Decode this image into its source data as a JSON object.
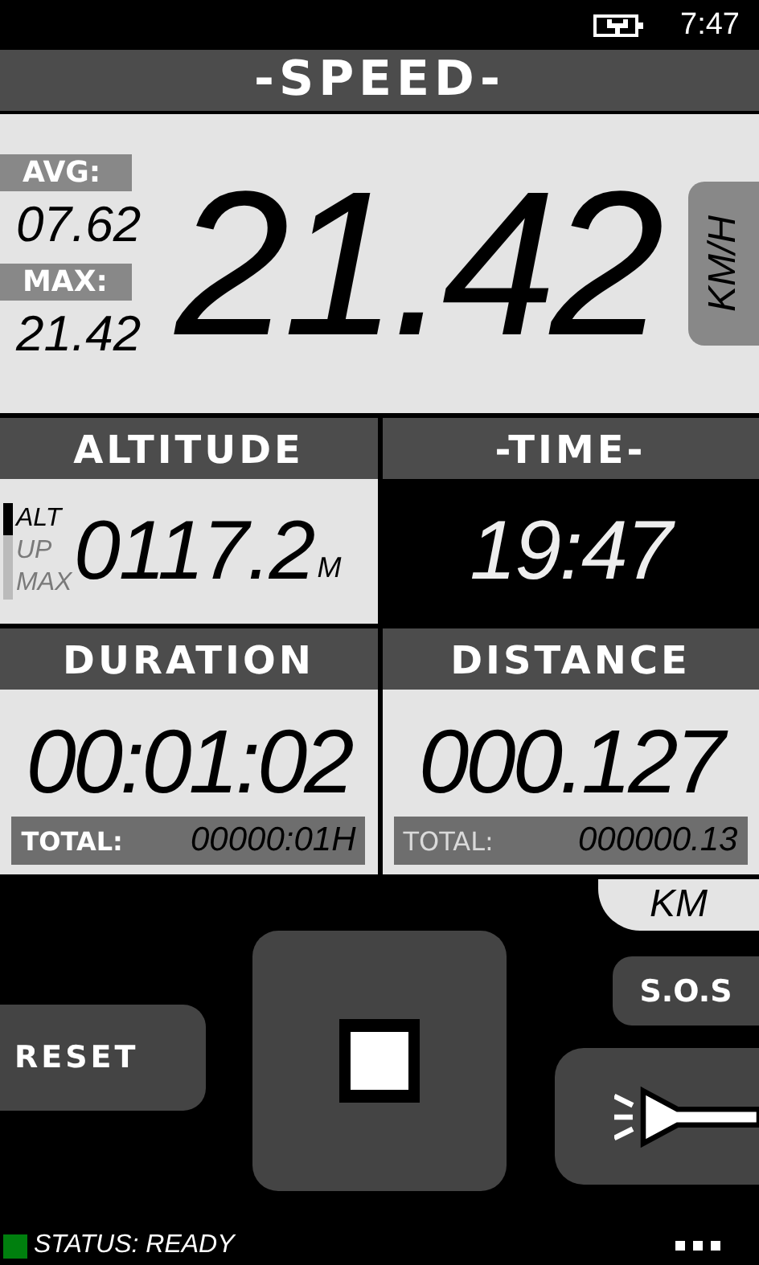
{
  "status_bar": {
    "time": "7:47"
  },
  "speed": {
    "title": "-SPEED-",
    "avg_label": "AVG:",
    "avg": "07.62",
    "max_label": "MAX:",
    "max": "21.42",
    "value": "21.42",
    "unit": "KM/H"
  },
  "altitude": {
    "title": "ALTITUDE",
    "value": "0117.2",
    "unit": "M",
    "modes": [
      {
        "label": "ALT",
        "selected": true
      },
      {
        "label": "UP",
        "selected": false
      },
      {
        "label": "MAX",
        "selected": false
      }
    ]
  },
  "time": {
    "title": "-TIME-",
    "value": "19:47"
  },
  "duration": {
    "title": "DURATION",
    "value": "00:01:02",
    "total_label": "TOTAL:",
    "total_dimmed": false,
    "total": "00000:01H"
  },
  "distance": {
    "title": "DISTANCE",
    "value": "000.127",
    "total_label": "TOTAL:",
    "total_dimmed": true,
    "total": "000000.13",
    "unit": "KM"
  },
  "buttons": {
    "reset": "RESET",
    "sos": "S.O.S"
  },
  "app_status": {
    "text": "STATUS: READY",
    "color": "#007f0e"
  }
}
